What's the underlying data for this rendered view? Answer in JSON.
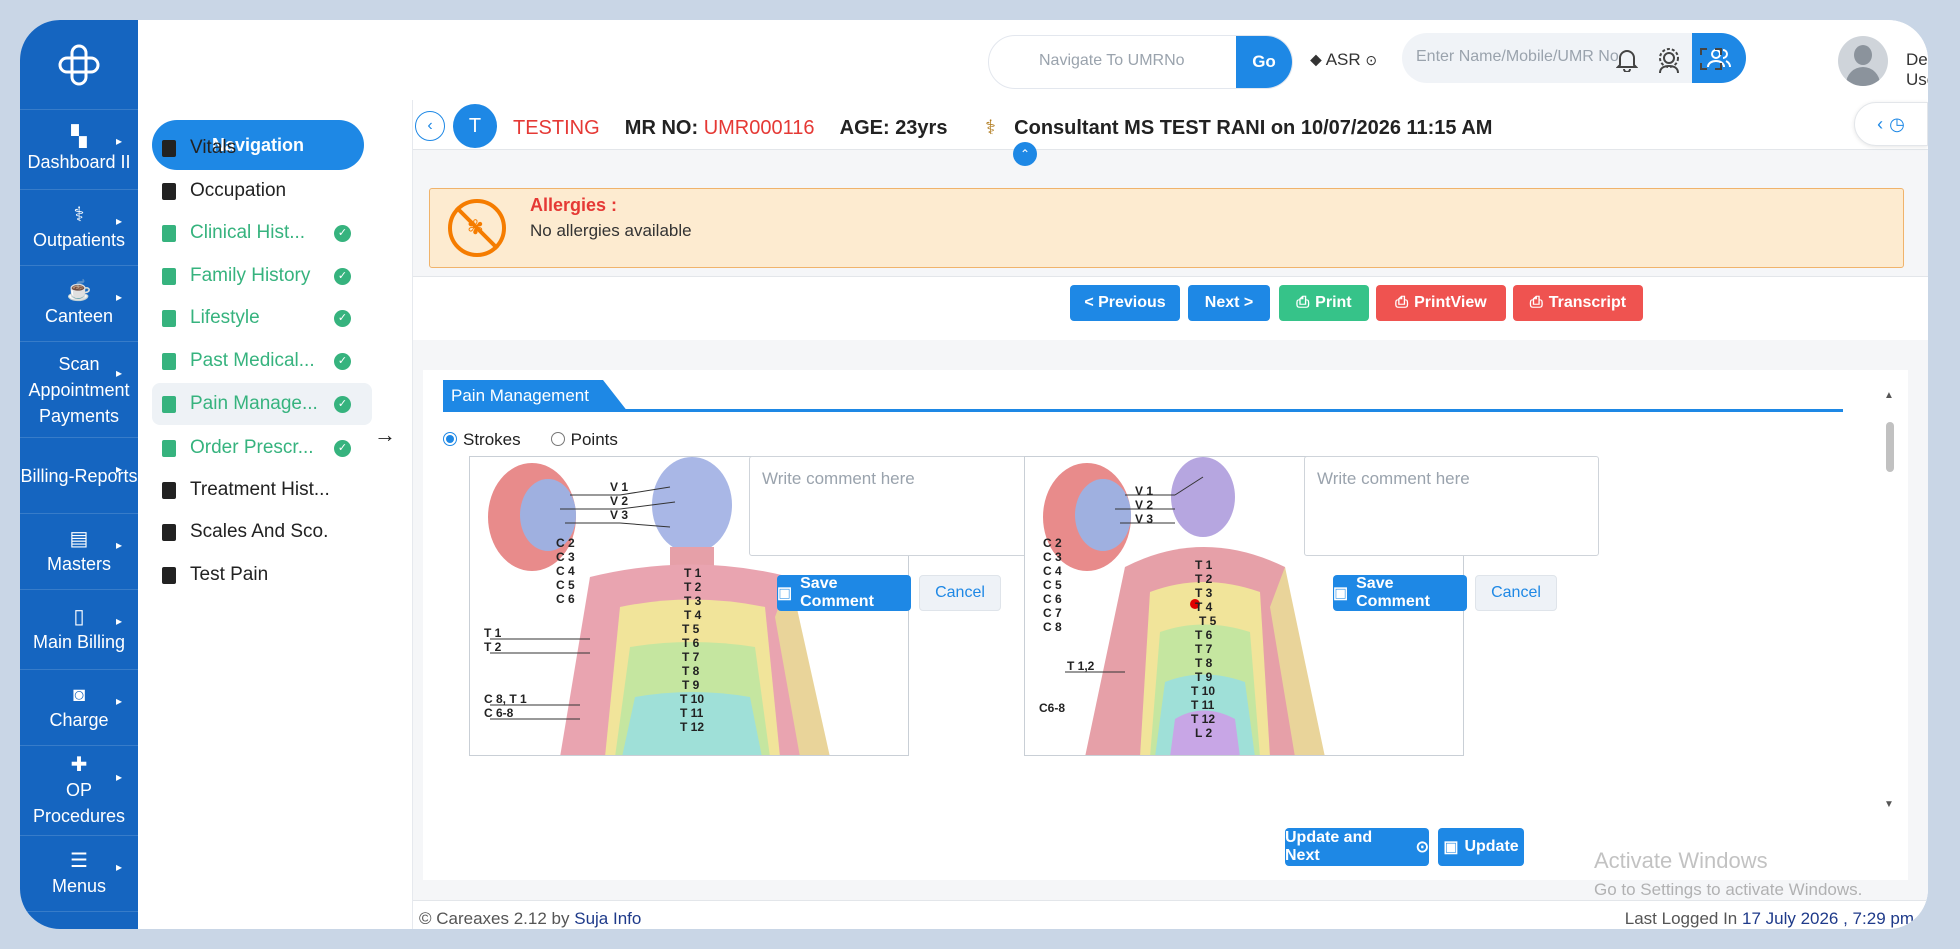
{
  "rail": {
    "items": [
      {
        "label": "Dashboard II",
        "icon": "dashboard-icon",
        "glyph": "▚"
      },
      {
        "label": "Outpatients",
        "icon": "stethoscope-icon",
        "glyph": "⚕"
      },
      {
        "label": "Canteen",
        "icon": "canteen-icon",
        "glyph": "☕"
      },
      {
        "label": "Scan Appointment Payments",
        "icon": "scan-icon",
        "glyph": ""
      },
      {
        "label": "Billing-Reports",
        "icon": "billing-icon",
        "glyph": ""
      },
      {
        "label": "Masters",
        "icon": "masters-icon",
        "glyph": "▤"
      },
      {
        "label": "Main Billing",
        "icon": "main-billing-icon",
        "glyph": "▯"
      },
      {
        "label": "Charge",
        "icon": "charge-icon",
        "glyph": "◙"
      },
      {
        "label": "OP Procedures",
        "icon": "procedures-icon",
        "glyph": "✚"
      },
      {
        "label": "Menus",
        "icon": "menus-icon",
        "glyph": "☰"
      }
    ]
  },
  "header": {
    "umr_placeholder": "Navigate To UMRNo",
    "go_label": "Go",
    "location": "ASR",
    "search_placeholder": "Enter Name/Mobile/UMR No",
    "user_name": "Demo User"
  },
  "nav": {
    "title": "Navigation",
    "items": [
      {
        "label": "Vitals",
        "done": false
      },
      {
        "label": "Occupation",
        "done": false
      },
      {
        "label": "Clinical Hist...",
        "done": true
      },
      {
        "label": "Family History",
        "done": true
      },
      {
        "label": "Lifestyle",
        "done": true
      },
      {
        "label": "Past Medical...",
        "done": true
      },
      {
        "label": "Pain Manage...",
        "done": true,
        "active": true
      },
      {
        "label": "Order Prescr...",
        "done": true
      },
      {
        "label": "Treatment Hist...",
        "done": false
      },
      {
        "label": "Scales And Sco...",
        "done": false
      },
      {
        "label": "Test Pain",
        "done": false
      }
    ]
  },
  "patient": {
    "avatar_letter": "T",
    "name": "TESTING",
    "mr_label": "MR NO:",
    "mr_no": "UMR000116",
    "age_label": "AGE:",
    "age": "23yrs",
    "consultant_label": "Consultant",
    "consultant": "MS TEST RANI",
    "on_label": "on",
    "datetime": "10/07/2026 11:15 AM"
  },
  "allergy": {
    "title": "Allergies :",
    "text": "No allergies available"
  },
  "actions": {
    "previous": "< Previous",
    "next": "Next >",
    "print": "Print",
    "printview": "PrintView",
    "transcript": "Transcript"
  },
  "pain": {
    "tab": "Pain Management",
    "mode_strokes": "Strokes",
    "mode_points": "Points",
    "selected_mode": "Strokes",
    "comment_placeholder": "Write comment here",
    "save_comment": "Save Comment",
    "cancel": "Cancel",
    "front_labels": [
      "V 1",
      "V 2",
      "V 3",
      "C 2",
      "C 3",
      "C 4",
      "C 5",
      "C 6",
      "T 1",
      "T 2",
      "C 8, T 1",
      "C 6-8",
      "T 1",
      "T 2",
      "T 3",
      "T 4",
      "T 5",
      "T 6",
      "T 7",
      "T 8",
      "T 9",
      "T 10",
      "T 11",
      "T 12"
    ],
    "back_labels": [
      "V 1",
      "V 2",
      "V 3",
      "C 2",
      "C 3",
      "C 4",
      "C 5",
      "C 6",
      "C 7",
      "C 8",
      "T 1,2",
      "C6-8",
      "T 1",
      "T 2",
      "T 3",
      "T 4",
      "T 5",
      "T 6",
      "T 7",
      "T 8",
      "T 9",
      "T 10",
      "T 11",
      "T 12",
      "L 2"
    ]
  },
  "bottom": {
    "update_next": "Update and Next",
    "update": "Update"
  },
  "watermark": {
    "line1": "Activate Windows",
    "line2": "Go to Settings to activate Windows."
  },
  "footer": {
    "copyright": "© Careaxes 2.12 by",
    "company": "Suja Info",
    "last_logged_label": "Last Logged In",
    "last_logged": "17 July 2026 , 7:29 pm"
  }
}
